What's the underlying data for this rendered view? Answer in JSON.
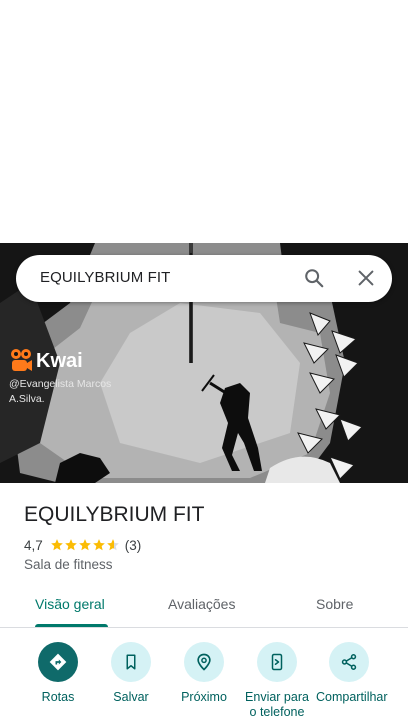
{
  "search": {
    "query": "EQUILYBRIUM FIT"
  },
  "photo_overlay": {
    "brand": "Kwai",
    "user": "@Evangelista Marcos A.Silva."
  },
  "place": {
    "title": "EQUILYBRIUM FIT",
    "rating": "4,7",
    "rating_value": 4.7,
    "review_count": "(3)",
    "category": "Sala de fitness"
  },
  "tabs": [
    {
      "label": "Visão geral",
      "active": true
    },
    {
      "label": "Avaliações",
      "active": false
    },
    {
      "label": "Sobre",
      "active": false
    }
  ],
  "actions": [
    {
      "label": "Rotas",
      "icon": "directions-icon"
    },
    {
      "label": "Salvar",
      "icon": "bookmark-icon"
    },
    {
      "label": "Próximo",
      "icon": "nearby-icon"
    },
    {
      "label": "Enviar para o telefone",
      "icon": "send-to-phone-icon"
    },
    {
      "label": "Compartilhar",
      "icon": "share-icon"
    }
  ],
  "colors": {
    "accent": "#00796b",
    "action_bg": "#d5f2f5",
    "primary_action": "#0f6a6a",
    "star": "#fbbc04"
  }
}
